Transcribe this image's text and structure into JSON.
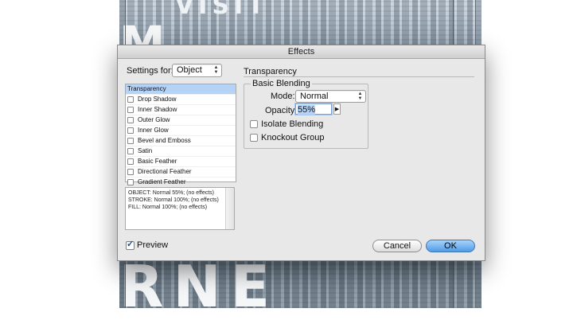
{
  "background": {
    "top_word": "VISIT",
    "big_word": "M",
    "bottom_word": "RNE"
  },
  "dialog": {
    "title": "Effects",
    "settings_for_label": "Settings for:",
    "settings_for_value": "Object",
    "effects_list": [
      {
        "label": "Transparency",
        "selected": true,
        "checkbox": false
      },
      {
        "label": "Drop Shadow",
        "selected": false,
        "checkbox": true
      },
      {
        "label": "Inner Shadow",
        "selected": false,
        "checkbox": true
      },
      {
        "label": "Outer Glow",
        "selected": false,
        "checkbox": true
      },
      {
        "label": "Inner Glow",
        "selected": false,
        "checkbox": true
      },
      {
        "label": "Bevel and Emboss",
        "selected": false,
        "checkbox": true
      },
      {
        "label": "Satin",
        "selected": false,
        "checkbox": true
      },
      {
        "label": "Basic Feather",
        "selected": false,
        "checkbox": true
      },
      {
        "label": "Directional Feather",
        "selected": false,
        "checkbox": true
      },
      {
        "label": "Gradient Feather",
        "selected": false,
        "checkbox": true
      }
    ],
    "summary_lines": [
      "OBJECT: Normal 55%; (no effects)",
      "STROKE: Normal 100%; (no effects)",
      "FILL: Normal 100%; (no effects)"
    ],
    "section_title": "Transparency",
    "basic_blending": {
      "legend": "Basic Blending",
      "mode_label": "Mode:",
      "mode_value": "Normal",
      "opacity_label": "Opacity:",
      "opacity_value": "55%"
    },
    "isolate_blending_label": "Isolate Blending",
    "knockout_group_label": "Knockout Group",
    "preview_label": "Preview",
    "preview_checked": true,
    "cancel_label": "Cancel",
    "ok_label": "OK"
  },
  "colors": {
    "selection": "#b5d3f7",
    "ok_button": "#4f9be6",
    "guide_margin": "#c2333f",
    "guide_bleed": "#7a4fd0"
  }
}
